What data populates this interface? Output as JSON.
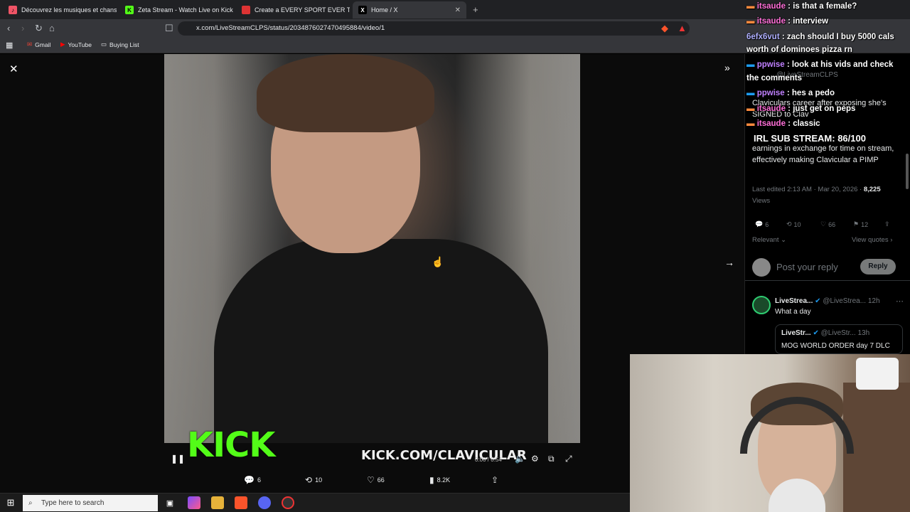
{
  "browser": {
    "tabs": [
      {
        "title": "Découvrez les musiques et chansons",
        "icon": "deezer-icon"
      },
      {
        "title": "Zeta Stream - Watch Live on Kick",
        "icon": "kick-icon"
      },
      {
        "title": "Create a EVERY SPORT EVER Tier List",
        "icon": "tiermaker-icon"
      },
      {
        "title": "Home / X",
        "icon": "x-icon"
      }
    ],
    "url": "x.com/LiveStreamCLPS/status/2034876027470495884/video/1",
    "bookmarks": [
      "Gmail",
      "YouTube",
      "Buying List"
    ]
  },
  "video": {
    "overlay_logo": "KICK",
    "overlay_url": "KICK.COM/CLAVICULAR",
    "time": "0:00 / 0:54"
  },
  "tweet_actions": {
    "replies": "6",
    "reposts": "10",
    "likes": "66",
    "views": "8.2K"
  },
  "right_panel": {
    "handle": "@LiveStreamCLPS",
    "body": "Claviculars career after exposing she's SIGNED to Clav",
    "body2": "earnings in exchange for time on stream, effectively making Clavicular a PIMP",
    "meta": "Last edited 2:13 AM · Mar 20, 2026 · ",
    "views_count": "8,225",
    "views_label": "Views",
    "stats": {
      "replies": "6",
      "reposts": "10",
      "likes": "66",
      "bookmarks": "12"
    },
    "sort": "Relevant",
    "view_quotes": "View quotes",
    "reply_placeholder": "Post your reply",
    "reply_button": "Reply",
    "reply1": {
      "name": "LiveStrea...",
      "handle": "@LiveStrea...",
      "time": "12h",
      "text": "What a day"
    },
    "reply2": {
      "name": "LiveStr...",
      "handle": "@LiveStr...",
      "time": "13h",
      "text": "MOG WORLD ORDER day 7 DLC"
    }
  },
  "chat": [
    {
      "user": "itsaude",
      "msg": " : is that a female?"
    },
    {
      "user": "itsaude",
      "msg": " : interview"
    },
    {
      "user": "6efx6vut",
      "msg": " : zach should I buy 5000 cals"
    },
    {
      "user": "",
      "msg": "worth of dominoes pizza rn"
    },
    {
      "user": "ppwise",
      "msg": " : look at his vids and check"
    },
    {
      "user": "",
      "msg": "the comments"
    },
    {
      "user": "ppwise",
      "msg": " : hes a pedo"
    },
    {
      "user": "itsaude",
      "msg": " : just get on peps"
    },
    {
      "user": "itsaude",
      "msg": " : classic"
    }
  ],
  "sub_stream": "IRL SUB STREAM: 86/100",
  "taskbar": {
    "search_placeholder": "Type here to search"
  }
}
